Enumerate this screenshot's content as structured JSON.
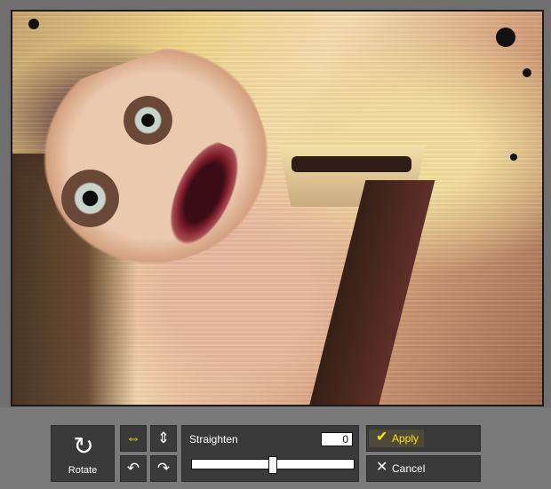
{
  "toolbar": {
    "rotate_label": "Rotate",
    "straighten_label": "Straighten",
    "straighten_value": "0",
    "straighten_fraction": 0.5,
    "apply_label": "Apply",
    "cancel_label": "Cancel"
  },
  "icons": {
    "rotate": "rotate-icon",
    "flip_horizontal": "flip-horizontal-icon",
    "flip_vertical": "flip-vertical-icon",
    "rotate_left": "rotate-left-icon",
    "rotate_right": "rotate-right-icon",
    "apply": "checkmark-icon",
    "cancel": "close-icon"
  },
  "colors": {
    "toolbar_bg": "#7a7a7a",
    "button_bg": "#3a3a3a",
    "accent": "#ffe400"
  }
}
